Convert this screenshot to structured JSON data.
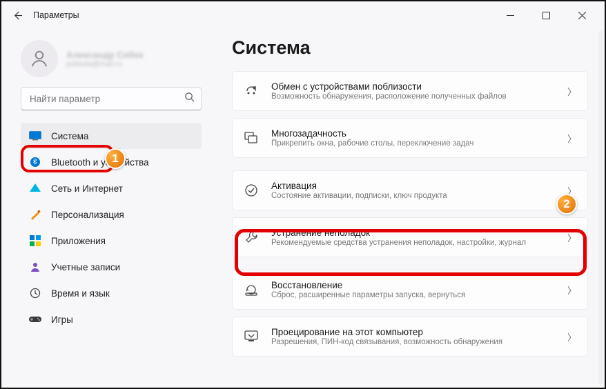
{
  "titlebar": {
    "title": "Параметры"
  },
  "user": {
    "name": "Александр Себек",
    "email": "pobeda@mail.ru"
  },
  "search": {
    "placeholder": "Найти параметр"
  },
  "nav": {
    "items": [
      {
        "label": "Система"
      },
      {
        "label": "Bluetooth и устройства"
      },
      {
        "label": "Сеть и Интернет"
      },
      {
        "label": "Персонализация"
      },
      {
        "label": "Приложения"
      },
      {
        "label": "Учетные записи"
      },
      {
        "label": "Время и язык"
      },
      {
        "label": "Игры"
      }
    ]
  },
  "page": {
    "title": "Система"
  },
  "cards": [
    {
      "title": "Обмен с устройствами поблизости",
      "sub": "Возможность обнаружения, расположение полученных файлов"
    },
    {
      "title": "Многозадачность",
      "sub": "Прикрепить окна, рабочие столы, переключение задач"
    },
    {
      "title": "Активация",
      "sub": "Состояние активации, подписки, ключ продукта"
    },
    {
      "title": "Устранение неполадок",
      "sub": "Рекомендуемые средства устранения неполадок, настройки, журнал"
    },
    {
      "title": "Восстановление",
      "sub": "Сброс, расширенные параметры запуска, вернуться"
    },
    {
      "title": "Проецирование на этот компьютер",
      "sub": "Разрешения, ПИН-код связывания, возможность обнаружения"
    }
  ],
  "badges": {
    "one": "1",
    "two": "2"
  }
}
